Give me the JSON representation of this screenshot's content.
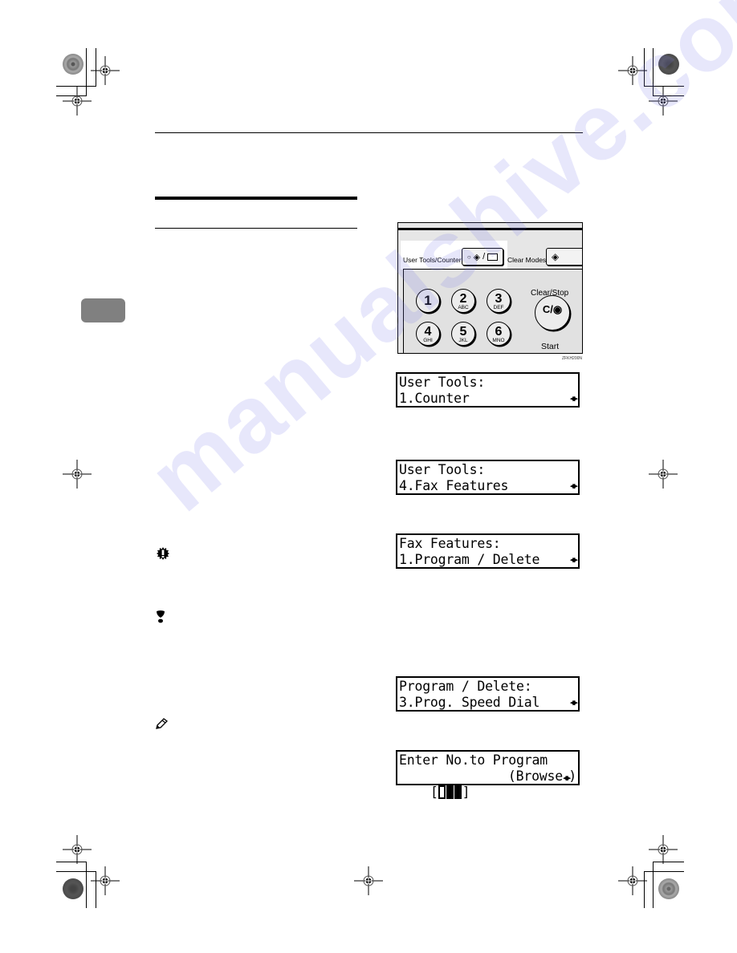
{
  "page": {
    "watermark": "manualshive.com",
    "side_tab": {
      "color": "#808080"
    }
  },
  "control_panel": {
    "user_tools_label": "User Tools/Counter",
    "clear_modes_label": "Clear Modes",
    "clear_stop_label": "Clear/Stop",
    "clear_stop_glyph": "C/◉",
    "start_label": "Start",
    "figure_code": "ZFKH200N",
    "keys": [
      {
        "num": "1",
        "letters": ""
      },
      {
        "num": "2",
        "letters": "ABC"
      },
      {
        "num": "3",
        "letters": "DEF"
      },
      {
        "num": "4",
        "letters": "GHI"
      },
      {
        "num": "5",
        "letters": "JKL"
      },
      {
        "num": "6",
        "letters": "MNO"
      }
    ]
  },
  "displays": [
    {
      "line1": "User Tools:",
      "line2": "1.Counter",
      "arrows": "◀▶"
    },
    {
      "line1": "User Tools:",
      "line2": "4.Fax Features",
      "arrows": "◀▶"
    },
    {
      "line1": "Fax Features:",
      "line2": "1.Program / Delete",
      "arrows": "◀▶"
    },
    {
      "line1": "Program / Delete:",
      "line2": "3.Prog. Speed Dial",
      "arrows": "◀▶"
    },
    {
      "line1": "Enter No.to Program",
      "line2_open": "[",
      "line2_close": "]",
      "line2_browse": "(Browse",
      "line2_browse_end": ")",
      "arrows": "◀▶"
    }
  ],
  "notes": {
    "important_icon": "important-icon",
    "limitation_icon": "limitation-icon",
    "note_icon": "note-pencil-icon"
  }
}
